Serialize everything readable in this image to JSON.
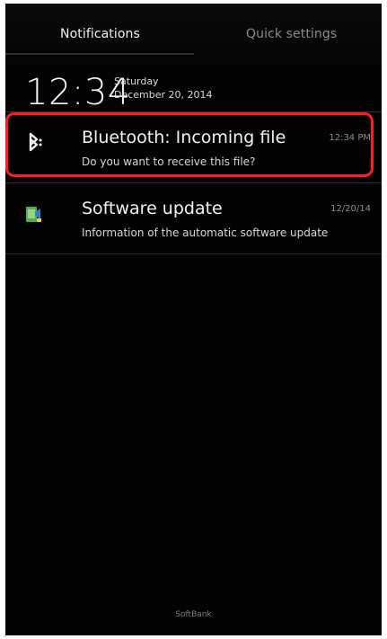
{
  "colors": {
    "background": "#030303",
    "highlight": "#ff1d24",
    "text_primary": "#f2f2f2",
    "text_secondary": "#8e8e8e"
  },
  "tabs": {
    "notifications": "Notifications",
    "quick_settings": "Quick settings",
    "active": "notifications"
  },
  "status": {
    "time": "12:34",
    "day": "Saturday",
    "date": "December 20, 2014"
  },
  "notifications": [
    {
      "icon": "bluetooth-icon",
      "title": "Bluetooth: Incoming file",
      "text": "Do you want to receive this file?",
      "time": "12:34 PM",
      "highlighted": true
    },
    {
      "icon": "software-update-icon",
      "title": "Software update",
      "text": "Information of the automatic software update",
      "time": "12/20/14",
      "highlighted": false
    }
  ],
  "footer": {
    "carrier": "SoftBank"
  }
}
